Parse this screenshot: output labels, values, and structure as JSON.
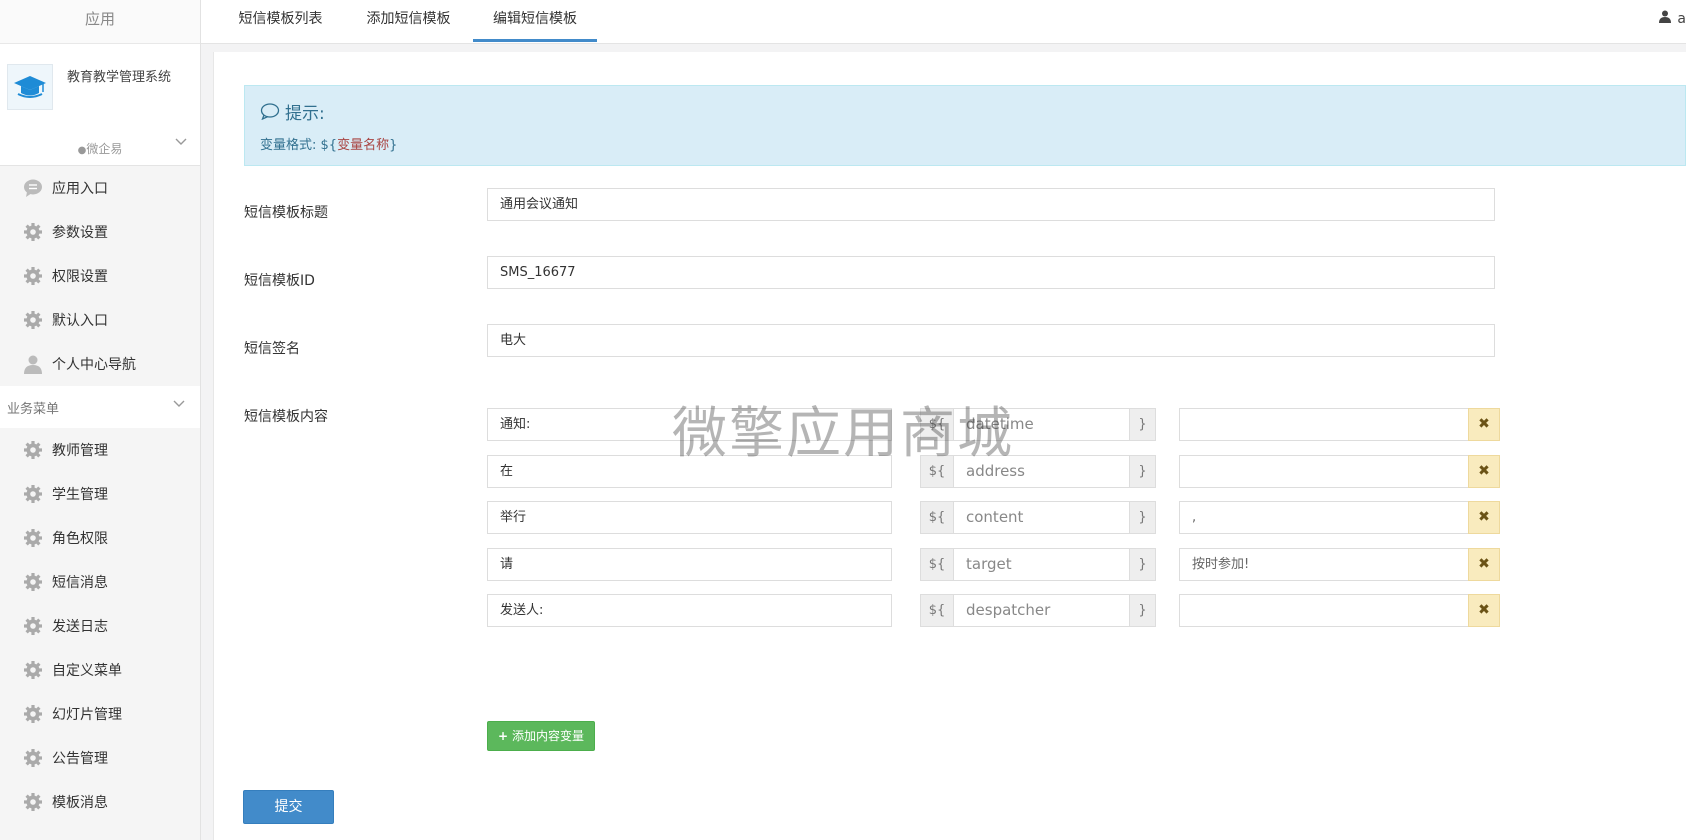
{
  "sidebar": {
    "header": "应用",
    "app_name": "教育教学管理系统",
    "app_sub": "微企易",
    "items_top": [
      {
        "label": "应用入口",
        "icon": "chat-icon"
      },
      {
        "label": "参数设置",
        "icon": "gear-icon"
      },
      {
        "label": "权限设置",
        "icon": "gear-icon"
      },
      {
        "label": "默认入口",
        "icon": "gear-icon"
      },
      {
        "label": "个人中心导航",
        "icon": "user-icon"
      }
    ],
    "group_label": "业务菜单",
    "items_business": [
      {
        "label": "教师管理"
      },
      {
        "label": "学生管理"
      },
      {
        "label": "角色权限"
      },
      {
        "label": "短信消息"
      },
      {
        "label": "发送日志"
      },
      {
        "label": "自定义菜单"
      },
      {
        "label": "幻灯片管理"
      },
      {
        "label": "公告管理"
      },
      {
        "label": "模板消息"
      }
    ]
  },
  "tabs": [
    {
      "label": "短信模板列表"
    },
    {
      "label": "添加短信模板"
    },
    {
      "label": "编辑短信模板",
      "active": true
    }
  ],
  "user": {
    "name": "a"
  },
  "alert": {
    "title": "提示:",
    "text_prefix": "变量格式: ${",
    "text_var": "变量名称",
    "text_suffix": "}"
  },
  "form": {
    "title_label": "短信模板标题",
    "title_value": "通用会议通知",
    "id_label": "短信模板ID",
    "id_value": "SMS_16677",
    "sign_label": "短信签名",
    "sign_value": "电大",
    "content_label": "短信模板内容",
    "rows": [
      {
        "prefix": "通知:",
        "var": "datetime",
        "value": ""
      },
      {
        "prefix": "在",
        "var": "address",
        "value": ""
      },
      {
        "prefix": "举行",
        "var": "content",
        "value": ","
      },
      {
        "prefix": "请",
        "var": "target",
        "value": "按时参加!"
      },
      {
        "prefix": "发送人:",
        "var": "despatcher",
        "value": ""
      }
    ],
    "addon_left": "${",
    "addon_right": "}",
    "delete_symbol": "✖",
    "add_button": "添加内容变量",
    "submit_button": "提交"
  },
  "watermark": "微擎应用商城",
  "colors": {
    "primary": "#428bca",
    "success": "#5cb85c",
    "info_bg": "#d9edf7",
    "warning_bg": "#f9ebbe"
  }
}
